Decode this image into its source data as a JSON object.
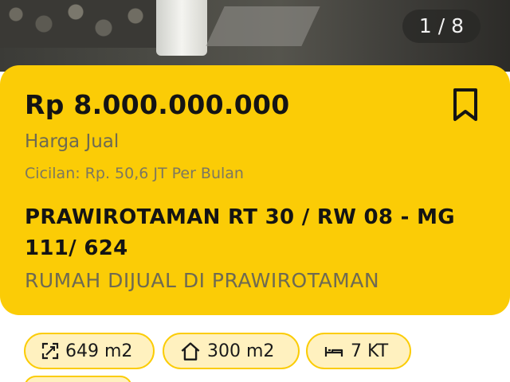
{
  "gallery": {
    "counter": "1 / 8"
  },
  "listing": {
    "price": "Rp 8.000.000.000",
    "price_type": "Harga Jual",
    "installment": "Cicilan: Rp. 50,6 JT Per Bulan",
    "title": "PRAWIROTAMAN RT 30 / RW 08 - MG 111/ 624",
    "subtitle": "RUMAH DIJUAL DI PRAWIROTAMAN"
  },
  "specs": [
    {
      "icon": "land-area-icon",
      "label": "649 m2"
    },
    {
      "icon": "building-area-icon",
      "label": "300 m2"
    },
    {
      "icon": "bed-icon",
      "label": "7 KT"
    }
  ],
  "colors": {
    "card": "#fbcc06",
    "chip_bg": "#fff1bf",
    "muted_text": "#6e6a52"
  }
}
